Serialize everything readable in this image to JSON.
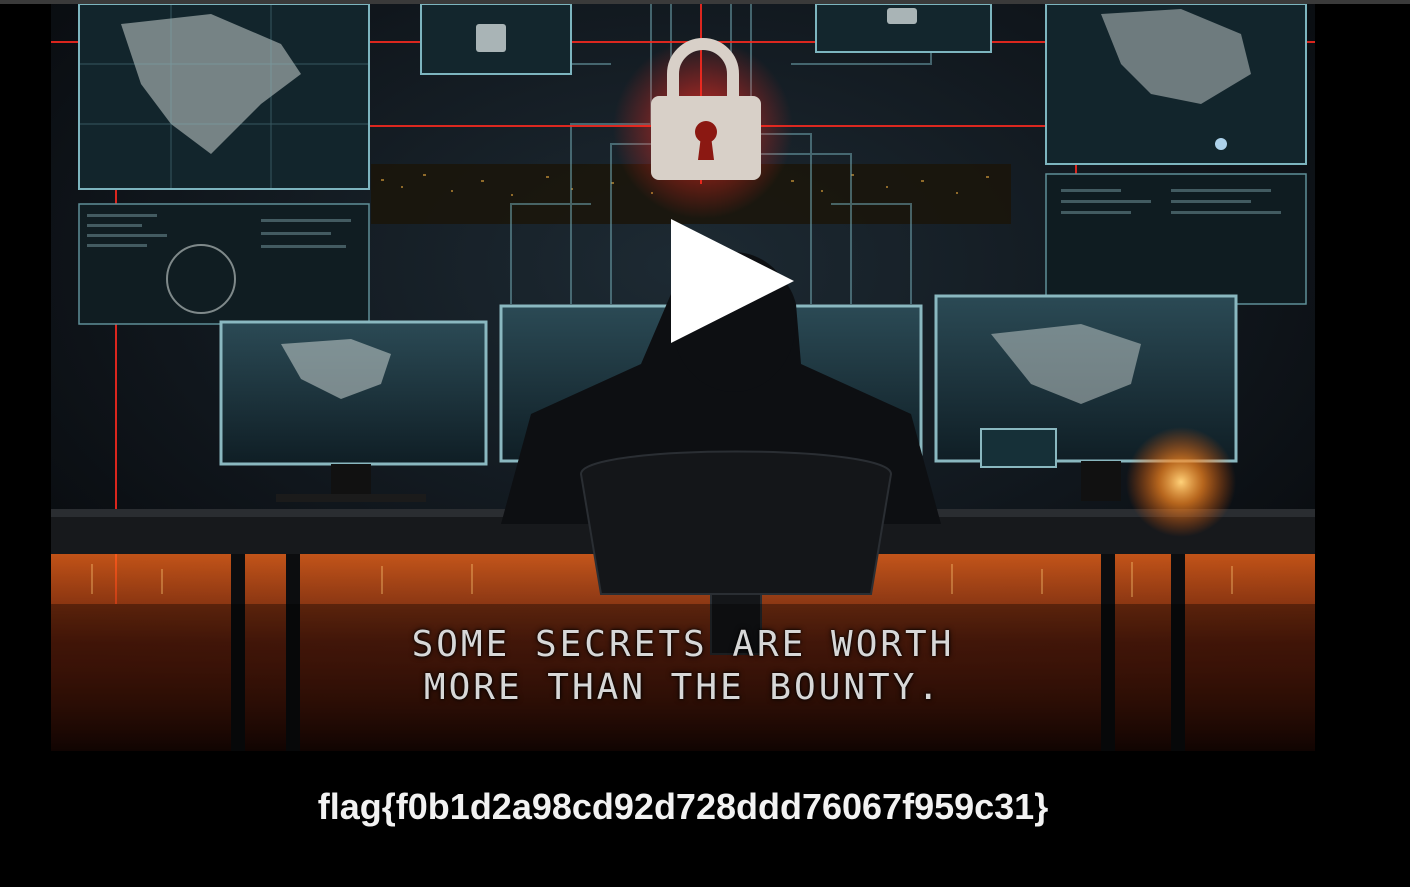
{
  "video": {
    "caption_line_1": "SOME SECRETS ARE WORTH",
    "caption_line_2": "MORE THAN THE BOUNTY.",
    "play_icon": "play-icon",
    "lock_icon": "padlock-icon"
  },
  "flag": {
    "text": "flag{f0b1d2a98cd92d728ddd76067f959c31}"
  },
  "colors": {
    "background": "#000000",
    "accent_red": "#e0231c",
    "accent_teal": "#3aa7b8",
    "flag_text": "#f2f2f2"
  }
}
